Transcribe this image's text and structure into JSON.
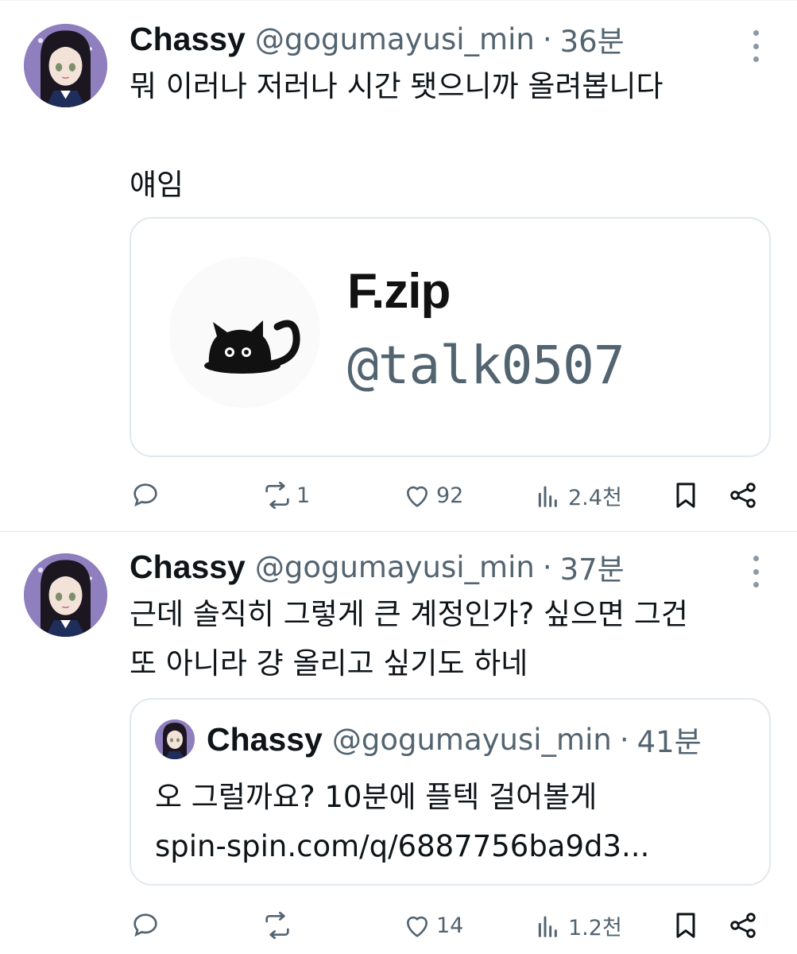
{
  "tweets": [
    {
      "author": {
        "name": "Chassy",
        "handle": "@gogumayusi_min"
      },
      "time": "36분",
      "text_lines": [
        "뭐 이러나 저러나 시간 됏으니까 올려봅니다",
        "",
        "얘임"
      ],
      "profile_card": {
        "name": "F.zip",
        "handle": "@talk0507"
      },
      "actions": {
        "reply": "",
        "retweet": "1",
        "like": "92",
        "views": "2.4천"
      }
    },
    {
      "author": {
        "name": "Chassy",
        "handle": "@gogumayusi_min"
      },
      "time": "37분",
      "text_lines": [
        "근데 솔직히 그렇게 큰 계정인가? 싶으면 그건",
        "또 아니라 걍 올리고 싶기도 하네"
      ],
      "quote": {
        "author": {
          "name": "Chassy",
          "handle": "@gogumayusi_min"
        },
        "time": "41분",
        "text_lines": [
          "오 그럴까요? 10분에 플텍 걸어볼게",
          "spin-spin.com/q/6887756ba9d3..."
        ]
      },
      "actions": {
        "reply": "",
        "retweet": "",
        "like": "14",
        "views": "1.2천"
      }
    }
  ],
  "separator": "·",
  "icons": [
    "reply-icon",
    "retweet-icon",
    "like-icon",
    "views-icon",
    "bookmark-icon",
    "share-icon",
    "more-icon"
  ],
  "colors": {
    "secondary_text": "#536471",
    "divider": "#e1e8ed",
    "text": "#0f1419"
  }
}
